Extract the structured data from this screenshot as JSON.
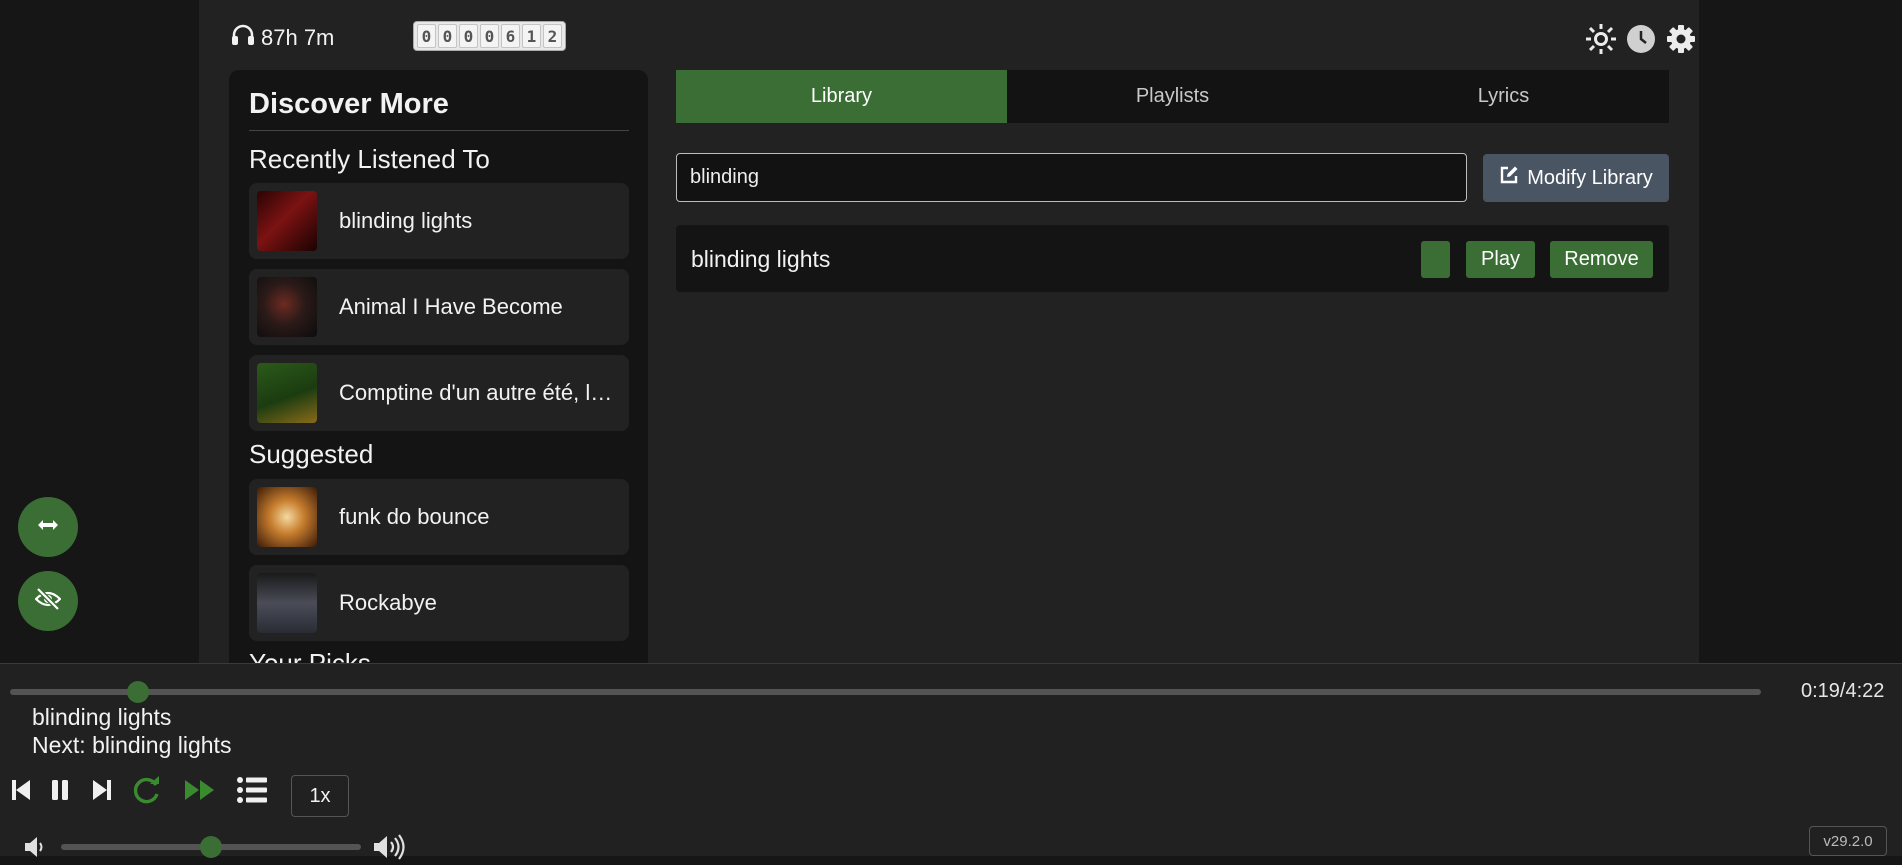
{
  "header": {
    "listen_time": "87h 7m",
    "counter_digits": [
      "0",
      "0",
      "0",
      "0",
      "6",
      "1",
      "2"
    ]
  },
  "sidebar": {
    "title": "Discover More",
    "recent_title": "Recently Listened To",
    "recent": [
      {
        "title": "blinding lights"
      },
      {
        "title": "Animal I Have Become"
      },
      {
        "title": "Comptine d'un autre été, l'après-midi"
      }
    ],
    "suggested_title": "Suggested",
    "suggested": [
      {
        "title": "funk do bounce"
      },
      {
        "title": "Rockabye"
      }
    ],
    "picks_title": "Your Picks"
  },
  "tabs": [
    {
      "label": "Library",
      "active": true
    },
    {
      "label": "Playlists",
      "active": false
    },
    {
      "label": "Lyrics",
      "active": false
    }
  ],
  "library": {
    "search_value": "blinding",
    "modify_label": "Modify Library",
    "results": [
      {
        "title": "blinding lights",
        "play_label": "Play",
        "remove_label": "Remove"
      }
    ]
  },
  "player": {
    "now_playing": "blinding lights",
    "next": "Next: blinding lights",
    "time": "0:19/4:22",
    "progress_fraction": 0.073,
    "volume_fraction": 0.5,
    "speed": "1x",
    "version": "v29.2.0"
  },
  "colors": {
    "accent": "#3a6e35",
    "background": "#222222",
    "panel": "#141414"
  }
}
